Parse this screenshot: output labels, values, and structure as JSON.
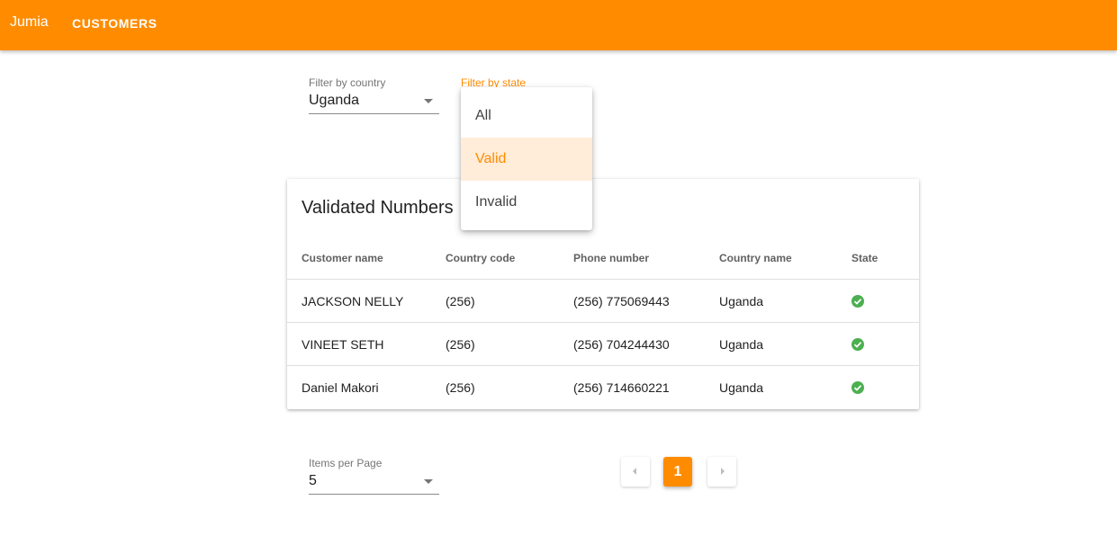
{
  "app": {
    "brand": "Jumia",
    "nav": [
      "CUSTOMERS"
    ]
  },
  "filters": {
    "country": {
      "label": "Filter by country",
      "value": "Uganda"
    },
    "state": {
      "label": "Filter by state",
      "options": [
        {
          "label": "All",
          "selected": false
        },
        {
          "label": "Valid",
          "selected": true
        },
        {
          "label": "Invalid",
          "selected": false
        }
      ]
    }
  },
  "table": {
    "title": "Validated Numbers",
    "columns": [
      "Customer name",
      "Country code",
      "Phone number",
      "Country name",
      "State"
    ],
    "rows": [
      {
        "name": "JACKSON NELLY",
        "code": "(256)",
        "phone": "(256) 775069443",
        "country": "Uganda",
        "state": "valid-check-icon"
      },
      {
        "name": "VINEET SETH",
        "code": "(256)",
        "phone": "(256) 704244430",
        "country": "Uganda",
        "state": "valid-check-icon"
      },
      {
        "name": "Daniel Makori",
        "code": "(256)",
        "phone": "(256) 714660221",
        "country": "Uganda",
        "state": "valid-check-icon"
      }
    ]
  },
  "pagination": {
    "items_per_page_label": "Items per Page",
    "items_per_page": "5",
    "current_page": "1"
  },
  "colors": {
    "accent": "#ff8c00",
    "valid": "#4caf50",
    "selected_bg": "#ffecd9"
  }
}
